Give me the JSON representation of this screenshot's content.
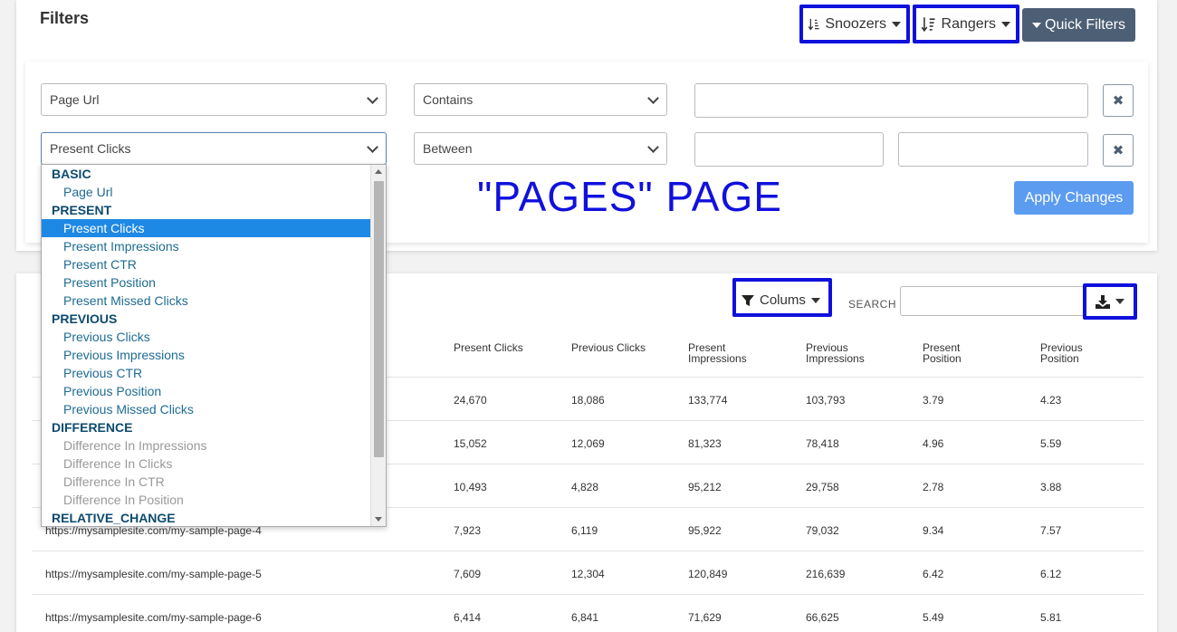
{
  "filters": {
    "title": "Filters",
    "snoozers_label": "Snoozers",
    "rangers_label": "Rangers",
    "quick_filters_label": "Quick Filters",
    "row1": {
      "field": "Page Url",
      "operator": "Contains"
    },
    "row2": {
      "field": "Present Clicks",
      "operator": "Between"
    },
    "apply_label": "Apply Changes",
    "remove_label": "✖"
  },
  "annotation": "\"PAGES\" PAGE",
  "dropdown": {
    "groups": [
      {
        "label": "BASIC",
        "options": [
          {
            "label": "Page Url"
          }
        ]
      },
      {
        "label": "PRESENT",
        "options": [
          {
            "label": "Present Clicks",
            "selected": true
          },
          {
            "label": "Present Impressions"
          },
          {
            "label": "Present CTR"
          },
          {
            "label": "Present Position"
          },
          {
            "label": "Present Missed Clicks"
          }
        ]
      },
      {
        "label": "PREVIOUS",
        "options": [
          {
            "label": "Previous Clicks"
          },
          {
            "label": "Previous Impressions"
          },
          {
            "label": "Previous CTR"
          },
          {
            "label": "Previous Position"
          },
          {
            "label": "Previous Missed Clicks"
          }
        ]
      },
      {
        "label": "DIFFERENCE",
        "options": [
          {
            "label": "Difference In Impressions",
            "disabled": true
          },
          {
            "label": "Difference In Clicks",
            "disabled": true
          },
          {
            "label": "Difference In CTR",
            "disabled": true
          },
          {
            "label": "Difference In Position",
            "disabled": true
          }
        ]
      },
      {
        "label": "RELATIVE_CHANGE",
        "options": []
      }
    ]
  },
  "table": {
    "columns_label": "Colums",
    "search_label": "SEARCH",
    "headers": [
      "Present Clicks",
      "Previous Clicks",
      "Present Impressions",
      "Previous Impressions",
      "Present Position",
      "Previous Position"
    ],
    "rows": [
      {
        "url": "",
        "cells": [
          "24,670",
          "18,086",
          "133,774",
          "103,793",
          "3.79",
          "4.23"
        ]
      },
      {
        "url": "",
        "cells": [
          "15,052",
          "12,069",
          "81,323",
          "78,418",
          "4.96",
          "5.59"
        ]
      },
      {
        "url": "",
        "cells": [
          "10,493",
          "4,828",
          "95,212",
          "29,758",
          "2.78",
          "3.88"
        ]
      },
      {
        "url": "https://mysamplesite.com/my-sample-page-4",
        "cells": [
          "7,923",
          "6,119",
          "95,922",
          "79,032",
          "9.34",
          "7.57"
        ]
      },
      {
        "url": "https://mysamplesite.com/my-sample-page-5",
        "cells": [
          "7,609",
          "12,304",
          "120,849",
          "216,639",
          "6.42",
          "6.12"
        ]
      },
      {
        "url": "https://mysamplesite.com/my-sample-page-6",
        "cells": [
          "6,414",
          "6,841",
          "71,629",
          "66,625",
          "5.49",
          "5.81"
        ]
      }
    ]
  },
  "colors": {
    "highlight": "#1010dd",
    "primary": "#5b9cf0",
    "dark_button": "#4d5f75",
    "selected": "#1e88e5"
  }
}
